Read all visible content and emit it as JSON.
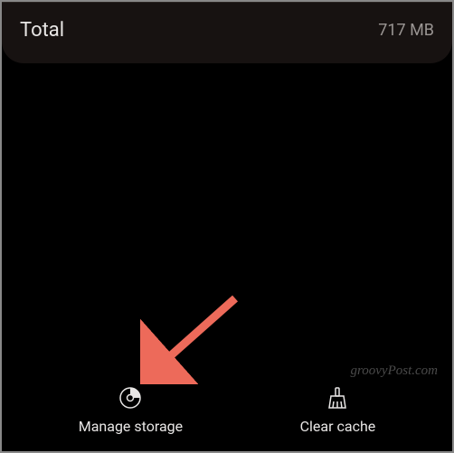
{
  "storage": {
    "total_label": "Total",
    "total_value": "717 MB"
  },
  "actions": {
    "manage_storage_label": "Manage storage",
    "clear_cache_label": "Clear cache"
  },
  "watermark": "groovyPost.com"
}
